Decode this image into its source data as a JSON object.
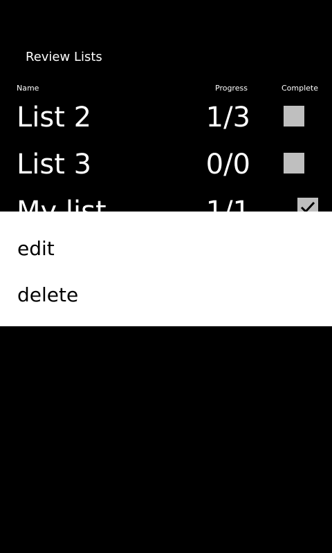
{
  "app": {
    "title": "Review Lists"
  },
  "columns": {
    "name": "Name",
    "progress": "Progress",
    "complete": "Complete"
  },
  "lists": [
    {
      "name": "List 2",
      "progress": "1/3",
      "complete": false
    },
    {
      "name": "List 3",
      "progress": "0/0",
      "complete": false
    },
    {
      "name": "My list",
      "progress": "1/1",
      "complete": true
    }
  ],
  "context_menu": {
    "items": [
      {
        "label": "edit"
      },
      {
        "label": "delete"
      }
    ]
  },
  "colors": {
    "background": "#000000",
    "text": "#ffffff",
    "checkbox": "#bfbfbf",
    "menu_background": "#ffffff",
    "menu_text": "#000000"
  }
}
